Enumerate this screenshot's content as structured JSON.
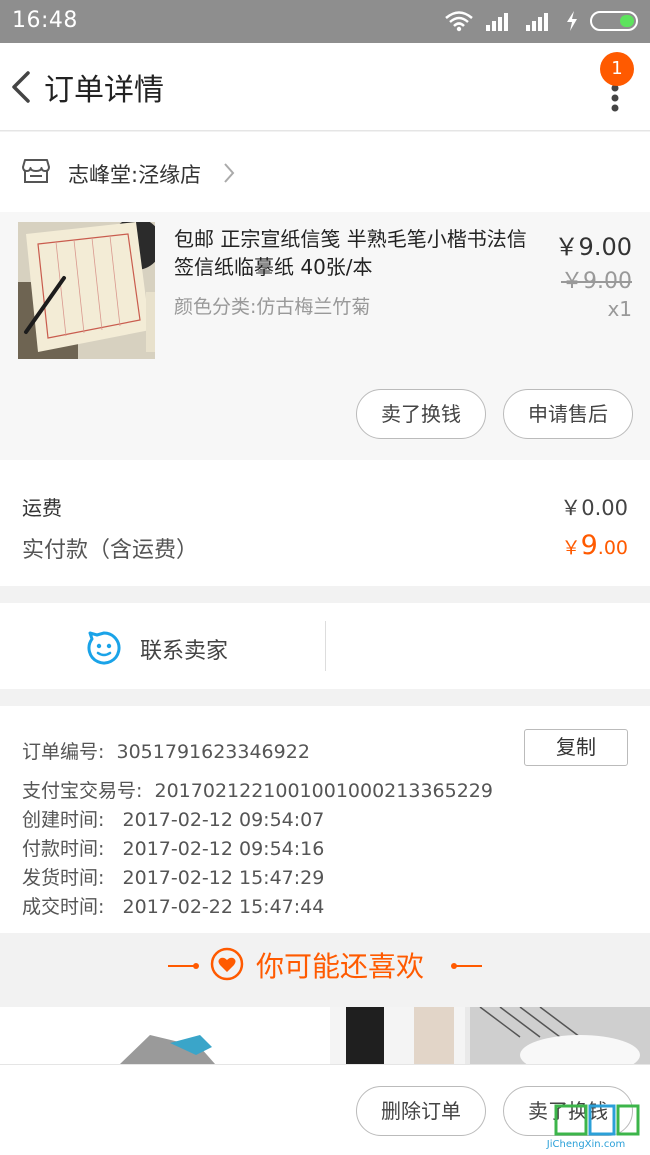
{
  "status_bar": {
    "time": "16:48"
  },
  "header": {
    "title": "订单详情",
    "badge_count": "1"
  },
  "shop": {
    "name": "志峰堂:泾缘店"
  },
  "item": {
    "title": "包邮 正宗宣纸信笺 半熟毛笔小楷书法信签信纸临摹纸 40张/本",
    "spec": "颜色分类:仿古梅兰竹菊",
    "price": "￥9.00",
    "original_price": "￥9.00",
    "quantity": "x1",
    "actions": {
      "sell": "卖了换钱",
      "after_sales": "申请售后"
    }
  },
  "fees": {
    "shipping_label": "运费",
    "shipping_value": "￥0.00",
    "paid_label": "实付款（含运费）",
    "paid_currency": "￥",
    "paid_integer": "9",
    "paid_decimal": ".00"
  },
  "contact": {
    "label": "联系卖家"
  },
  "order_info": {
    "order_no_label": "订单编号:",
    "order_no": "3051791623346922",
    "copy_label": "复制",
    "alipay_label": "支付宝交易号:",
    "alipay_no": "2017021221001001000213365229",
    "created_label": "创建时间:",
    "created": "2017-02-12 09:54:07",
    "paid_label": "付款时间:",
    "paid": "2017-02-12 09:54:16",
    "shipped_label": "发货时间:",
    "shipped": "2017-02-12 15:47:29",
    "closed_label": "成交时间:",
    "closed": "2017-02-22 15:47:44"
  },
  "recommend": {
    "title": "你可能还喜欢"
  },
  "bottom_actions": {
    "delete": "删除订单",
    "sell": "卖了换钱"
  },
  "watermark": {
    "text": "JiChengXin.com"
  },
  "colors": {
    "accent": "#ff5a00",
    "status_bar": "#8e8e8e",
    "page_bg": "#f2f2f2"
  }
}
